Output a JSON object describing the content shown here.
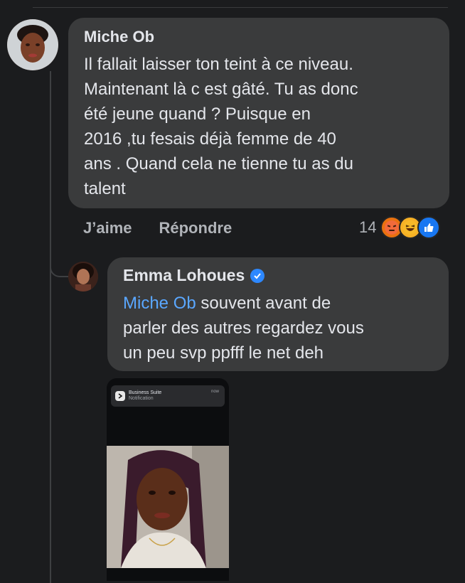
{
  "comment": {
    "author": "Miche Ob",
    "text": "Il fallait laisser ton teint à ce niveau.\nMaintenant là c est gâté.  Tu as donc\nété jeune quand ? Puisque en\n2016 ,tu fesais déjà femme de 40\nans . Quand cela ne tienne tu as du\ntalent",
    "like_label": "J’aime",
    "reply_label": "Répondre",
    "reaction_count": "14",
    "reactions": [
      "angry",
      "haha",
      "like"
    ]
  },
  "reply": {
    "author": "Emma Lohoues",
    "verified": true,
    "mention": "Miche Ob",
    "text": " souvent avant de\nparler des autres regardez vous\nun peu svp ppfff le net deh"
  },
  "attachment": {
    "notification_title": "Business Suite",
    "notification_subtitle": "Notification",
    "notification_time": "now"
  },
  "colors": {
    "background": "#1b1c1e",
    "bubble": "#3a3b3c",
    "mention": "#5aa7ff",
    "verified": "#2d88ff"
  }
}
